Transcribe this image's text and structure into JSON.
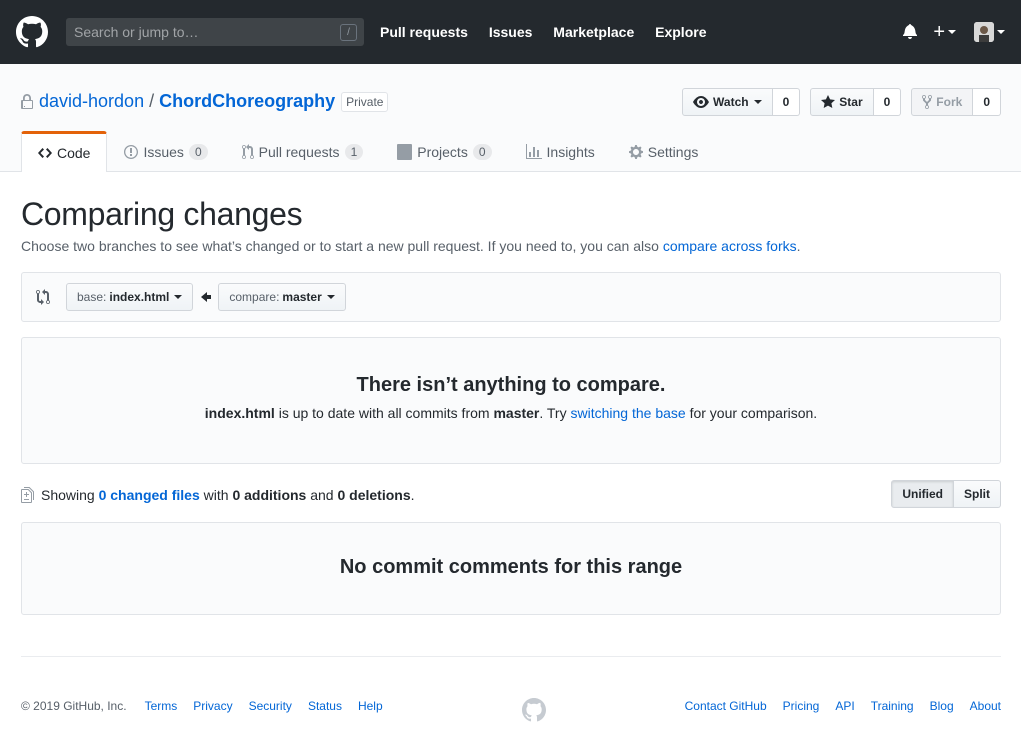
{
  "header": {
    "search_placeholder": "Search or jump to…",
    "search_shortcut": "/",
    "nav": [
      "Pull requests",
      "Issues",
      "Marketplace",
      "Explore"
    ],
    "plus": "+"
  },
  "repo": {
    "owner": "david-hordon",
    "separator": "/",
    "name": "ChordChoreography",
    "visibility": "Private",
    "watch_label": "Watch",
    "watch_count": "0",
    "star_label": "Star",
    "star_count": "0",
    "fork_label": "Fork",
    "fork_count": "0"
  },
  "tabs": {
    "code": "Code",
    "issues": "Issues",
    "issues_count": "0",
    "pulls": "Pull requests",
    "pulls_count": "1",
    "projects": "Projects",
    "projects_count": "0",
    "insights": "Insights",
    "settings": "Settings"
  },
  "compare": {
    "title": "Comparing changes",
    "subtitle": "Choose two branches to see what’s changed or to start a new pull request. If you need to, you can also",
    "subtitle_link": "compare across forks",
    "subtitle_end": ".",
    "base_prefix": "base:",
    "base_branch": "index.html",
    "compare_prefix": "compare:",
    "compare_branch": "master"
  },
  "blankslate": {
    "heading": "There isn’t anything to compare.",
    "branch_a": "index.html",
    "text1": "is up to date with all commits from",
    "branch_b": "master",
    "text2": ". Try",
    "link": "switching the base",
    "text3": "for your comparison."
  },
  "toc": {
    "showing": "Showing",
    "changed_files": "0 changed files",
    "with": "with",
    "additions": "0 additions",
    "and": "and",
    "deletions": "0 deletions",
    "period": ".",
    "unified": "Unified",
    "split": "Split"
  },
  "comments": {
    "heading": "No commit comments for this range"
  },
  "footer": {
    "copyright": "© 2019 GitHub, Inc.",
    "left_links": [
      "Terms",
      "Privacy",
      "Security",
      "Status",
      "Help"
    ],
    "right_links": [
      "Contact GitHub",
      "Pricing",
      "API",
      "Training",
      "Blog",
      "About"
    ]
  },
  "colors": {
    "header_bg": "#24292e",
    "link": "#0366d6",
    "tab_accent": "#e36209"
  }
}
